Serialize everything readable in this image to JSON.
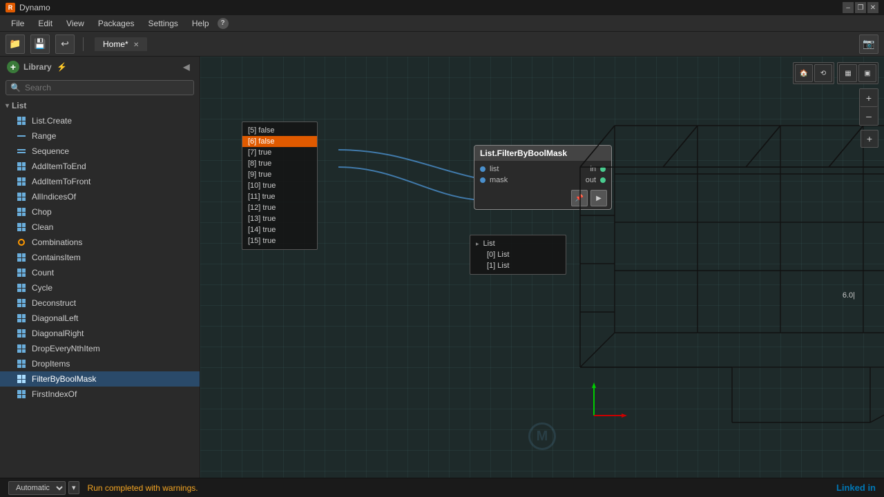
{
  "titlebar": {
    "app_name": "Dynamo",
    "icon_letter": "R",
    "win_buttons": [
      "–",
      "❐",
      "✕"
    ]
  },
  "menubar": {
    "items": [
      "File",
      "Edit",
      "View",
      "Packages",
      "Settings",
      "Help"
    ],
    "help_icon": "?"
  },
  "toolbar": {
    "buttons": [
      "📁",
      "💾",
      "↩"
    ],
    "camera_btn": "📷"
  },
  "tabs": {
    "home_tab": "Home*",
    "close": "✕"
  },
  "library": {
    "header": "Library",
    "search_placeholder": "Search",
    "section": "List",
    "items": [
      {
        "id": "list-create",
        "label": "List.Create",
        "icon_type": "grid"
      },
      {
        "id": "range",
        "label": "Range",
        "icon_type": "dash"
      },
      {
        "id": "sequence",
        "label": "Sequence",
        "icon_type": "dash"
      },
      {
        "id": "add-item-to-end",
        "label": "AddItemToEnd",
        "icon_type": "grid"
      },
      {
        "id": "add-item-to-front",
        "label": "AddItemToFront",
        "icon_type": "grid"
      },
      {
        "id": "all-indices-of",
        "label": "AllIndicesOf",
        "icon_type": "grid"
      },
      {
        "id": "chop",
        "label": "Chop",
        "icon_type": "grid"
      },
      {
        "id": "clean",
        "label": "Clean",
        "icon_type": "grid"
      },
      {
        "id": "combinations",
        "label": "Combinations",
        "icon_type": "circle"
      },
      {
        "id": "contains-item",
        "label": "ContainsItem",
        "icon_type": "grid"
      },
      {
        "id": "count",
        "label": "Count",
        "icon_type": "grid"
      },
      {
        "id": "cycle",
        "label": "Cycle",
        "icon_type": "grid"
      },
      {
        "id": "deconstruct",
        "label": "Deconstruct",
        "icon_type": "grid"
      },
      {
        "id": "diagonal-left",
        "label": "DiagonalLeft",
        "icon_type": "grid"
      },
      {
        "id": "diagonal-right",
        "label": "DiagonalRight",
        "icon_type": "grid"
      },
      {
        "id": "drop-every-nth-item",
        "label": "DropEveryNthItem",
        "icon_type": "grid"
      },
      {
        "id": "drop-items",
        "label": "DropItems",
        "icon_type": "grid"
      },
      {
        "id": "filter-by-bool-mask",
        "label": "FilterByBoolMask",
        "icon_type": "grid",
        "active": true
      },
      {
        "id": "first-index-of",
        "label": "FirstIndexOf",
        "icon_type": "grid"
      }
    ]
  },
  "bool_popup": {
    "rows": [
      {
        "label": "[5] false"
      },
      {
        "label": "[6] false",
        "highlighted": true
      },
      {
        "label": "[7] true"
      },
      {
        "label": "[8] true"
      },
      {
        "label": "[9] true"
      },
      {
        "label": "[10] true"
      },
      {
        "label": "[11] true"
      },
      {
        "label": "[12] true"
      },
      {
        "label": "[13] true"
      },
      {
        "label": "[14] true"
      },
      {
        "label": "[15] true"
      }
    ]
  },
  "node": {
    "title": "List.FilterByBoolMask",
    "inputs": [
      {
        "label": "list"
      },
      {
        "label": "mask"
      }
    ],
    "outputs": [
      {
        "label": "in"
      },
      {
        "label": "out"
      }
    ]
  },
  "output_popup": {
    "header": "▸ List",
    "items": [
      {
        "label": "[0] List"
      },
      {
        "label": "[1] List"
      }
    ]
  },
  "statusbar": {
    "run_mode": "Automatic",
    "run_arrow": "▾",
    "status_msg": "Run completed with warnings.",
    "linked_in": "Linked in"
  },
  "coord_label": "6.0|",
  "view_icons": [
    "🏠",
    "⟲"
  ],
  "zoom_icons": [
    "+",
    "–",
    "+"
  ],
  "canvas_bg_color": "#1e2a2a"
}
